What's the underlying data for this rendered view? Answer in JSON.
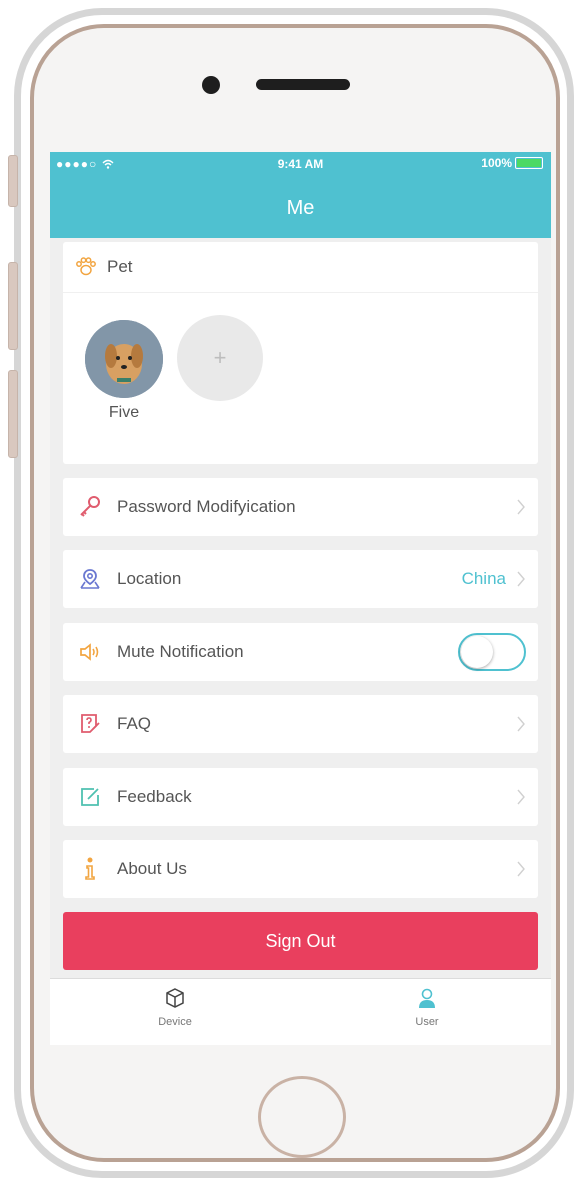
{
  "status_bar": {
    "signal": "●●●●○",
    "time": "9:41 AM",
    "battery": "100%"
  },
  "header": {
    "title": "Me"
  },
  "pet_section": {
    "title": "Pet",
    "pets": [
      {
        "name": "Five"
      }
    ],
    "add_label": "+"
  },
  "menu": {
    "password": {
      "label": "Password Modifyication"
    },
    "location": {
      "label": "Location",
      "value": "China"
    },
    "mute": {
      "label": "Mute Notification",
      "enabled": false
    },
    "faq": {
      "label": "FAQ"
    },
    "feedback": {
      "label": "Feedback"
    },
    "about": {
      "label": "About Us"
    }
  },
  "sign_out_label": "Sign Out",
  "tabs": [
    {
      "label": "Device",
      "icon": "cube-icon",
      "active": false
    },
    {
      "label": "User",
      "icon": "person-icon",
      "active": true
    }
  ],
  "colors": {
    "accent": "#4fc1d0",
    "sign_out": "#e93f5e",
    "pet_icon": "#f2a541",
    "key_icon": "#e05c6e",
    "location_icon": "#6a78d1",
    "mute_icon": "#f2a541",
    "faq_icon": "#e05c6e",
    "feedback_icon": "#4fc1b0",
    "about_icon": "#f2a541"
  }
}
